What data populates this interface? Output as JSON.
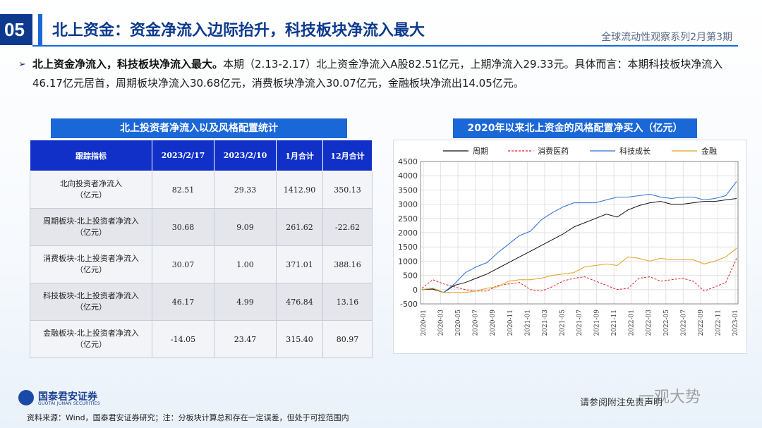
{
  "header": {
    "number": "05",
    "title": "北上资金：资金净流入边际抬升，科技板块净流入最大",
    "series": "全球流动性观察系列2月第3期"
  },
  "bullet": {
    "bold": "北上资金净流入，科技板块净流入最大。",
    "text": "本期（2.13-2.17）北上资金净流入A股82.51亿元，上期净流入29.33元。具体而言：本期科技板块净流入46.17亿元居首，周期板块净流入30.68亿元，消费板块净流入30.07亿元，金融板块净流出14.05亿元。"
  },
  "table": {
    "caption": "北上投资者净流入以及风格配置统计",
    "headers": [
      "跟踪指标",
      "2023/2/17",
      "2023/2/10",
      "1月合计",
      "12月合计"
    ],
    "rows": [
      {
        "label1": "北向投资者净流入",
        "label2": "（亿元）",
        "c1": "82.51",
        "c2": "29.33",
        "c3": "1412.90",
        "c4": "350.13"
      },
      {
        "label1": "周期板块-北上投资者净流入",
        "label2": "（亿元）",
        "c1": "30.68",
        "c2": "9.09",
        "c3": "261.62",
        "c4": "-22.62"
      },
      {
        "label1": "消费板块-北上投资者净流入",
        "label2": "（亿元）",
        "c1": "30.07",
        "c2": "1.00",
        "c3": "371.01",
        "c4": "388.16"
      },
      {
        "label1": "科技板块-北上投资者净流入",
        "label2": "（亿元）",
        "c1": "46.17",
        "c2": "4.99",
        "c3": "476.84",
        "c4": "13.16"
      },
      {
        "label1": "金融板块-北上投资者净流入",
        "label2": "（亿元）",
        "c1": "-14.05",
        "c2": "23.47",
        "c3": "315.40",
        "c4": "80.97"
      }
    ]
  },
  "chart_caption": "2020年以来北上资金的风格配置净买入（亿元）",
  "chart_data": {
    "type": "line",
    "title": "2020年以来北上资金的风格配置净买入（亿元）",
    "ylim": [
      -500,
      4500
    ],
    "yticks": [
      -500,
      0,
      500,
      1000,
      1500,
      2000,
      2500,
      3000,
      3500,
      4000,
      4500
    ],
    "xticks": [
      "2020-01",
      "2020-03",
      "2020-05",
      "2020-07",
      "2020-09",
      "2020-11",
      "2021-01",
      "2021-03",
      "2021-05",
      "2021-07",
      "2021-09",
      "2021-11",
      "2022-01",
      "2022-03",
      "2022-05",
      "2022-07",
      "2022-09",
      "2022-11",
      "2023-01"
    ],
    "legend_position": "top",
    "grid": true,
    "series": [
      {
        "name": "周期",
        "color": "#111111",
        "dash": "",
        "values": [
          0,
          20,
          -100,
          150,
          250,
          400,
          550,
          750,
          950,
          1150,
          1350,
          1550,
          1750,
          1950,
          2200,
          2350,
          2500,
          2650,
          2550,
          2800,
          2950,
          3050,
          3100,
          3000,
          3000,
          3050,
          3100,
          3100,
          3150,
          3200
        ]
      },
      {
        "name": "消费医药",
        "color": "#e02020",
        "dash": "3,2",
        "values": [
          50,
          350,
          200,
          100,
          0,
          -50,
          -50,
          150,
          200,
          250,
          0,
          -50,
          100,
          300,
          400,
          450,
          300,
          150,
          0,
          50,
          400,
          450,
          300,
          350,
          400,
          300,
          -50,
          100,
          250,
          1100
        ]
      },
      {
        "name": "科技成长",
        "color": "#2a6fd6",
        "dash": "",
        "values": [
          0,
          50,
          -100,
          200,
          600,
          800,
          950,
          1300,
          1600,
          1900,
          2050,
          2450,
          2700,
          2900,
          3050,
          3050,
          3050,
          3150,
          3250,
          3250,
          3300,
          3350,
          3250,
          3200,
          3250,
          3250,
          3150,
          3200,
          3300,
          3800
        ]
      },
      {
        "name": "金融",
        "color": "#e0a020",
        "dash": "",
        "values": [
          0,
          50,
          -100,
          -100,
          -100,
          -50,
          50,
          100,
          300,
          350,
          350,
          400,
          500,
          550,
          600,
          800,
          850,
          900,
          850,
          1150,
          1100,
          1000,
          1100,
          1050,
          1050,
          1050,
          900,
          1000,
          1150,
          1450
        ]
      }
    ]
  },
  "footer": {
    "logo_cn": "国泰君安证券",
    "logo_en": "GUOTAI JUNAN SECURITIES",
    "source": "资料来源：Wind，国泰君安证券研究；注：分板块计算总和存在一定误差，但处于可控范围内",
    "disclaimer": "请参阅附注免责声明",
    "watermark": "一观大势"
  }
}
